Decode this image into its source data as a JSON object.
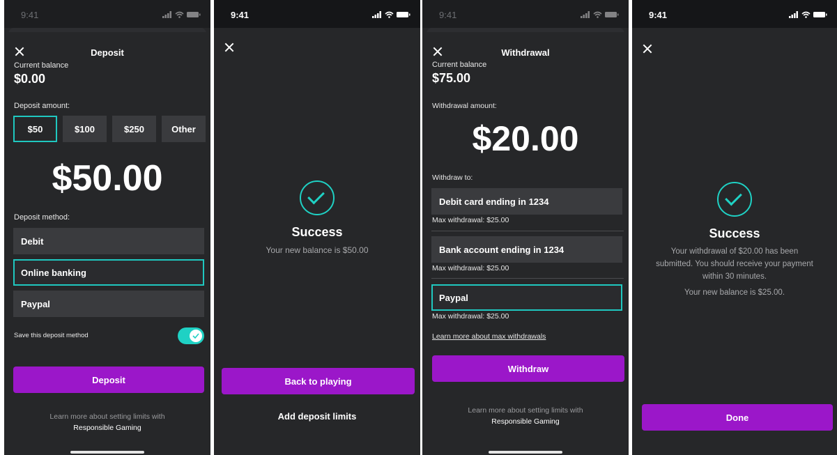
{
  "status": {
    "time": "9:41"
  },
  "deposit": {
    "title": "Deposit",
    "balance_label": "Current balance",
    "balance_value": "$0.00",
    "amount_label": "Deposit amount:",
    "amount_options": [
      "$50",
      "$100",
      "$250",
      "Other"
    ],
    "selected_amount": "$50",
    "big_amount": "$50.00",
    "method_label": "Deposit method:",
    "methods": [
      "Debit",
      "Online banking",
      "Paypal"
    ],
    "selected_method": "Online banking",
    "save_label": "Save this deposit method",
    "save_enabled": true,
    "button_label": "Deposit",
    "footer_text": "Learn more about setting limits with",
    "footer_link": "Responsible Gaming"
  },
  "deposit_success": {
    "title": "Success",
    "message": "Your new balance is $50.00",
    "primary_button": "Back to playing",
    "secondary_button": "Add deposit limits"
  },
  "withdrawal": {
    "title": "Withdrawal",
    "balance_label": "Current balance",
    "balance_value": "$75.00",
    "amount_label": "Withdrawal amount:",
    "big_amount": "$20.00",
    "withdraw_to_label": "Withdraw to:",
    "accounts": [
      {
        "label": "Debit card ending in 1234",
        "max": "Max withdrawal: $25.00"
      },
      {
        "label": "Bank account ending in 1234",
        "max": "Max withdrawal: $25.00"
      },
      {
        "label": "Paypal",
        "max": "Max withdrawal: $25.00"
      }
    ],
    "selected_account": "Paypal",
    "learn_more_link": "Learn more about max withdrawals",
    "button_label": "Withdraw",
    "footer_text": "Learn more about setting limits with",
    "footer_link": "Responsible Gaming"
  },
  "withdrawal_success": {
    "title": "Success",
    "message_line1": "Your withdrawal of $20.00 has been",
    "message_line2": "submitted. You should receive your payment",
    "message_line3": "within 30 minutes.",
    "message_line4": "Your new balance is $25.00.",
    "button_label": "Done"
  },
  "colors": {
    "accent": "#1fd1c4",
    "primary_button": "#9b17c9",
    "background": "#262729"
  }
}
